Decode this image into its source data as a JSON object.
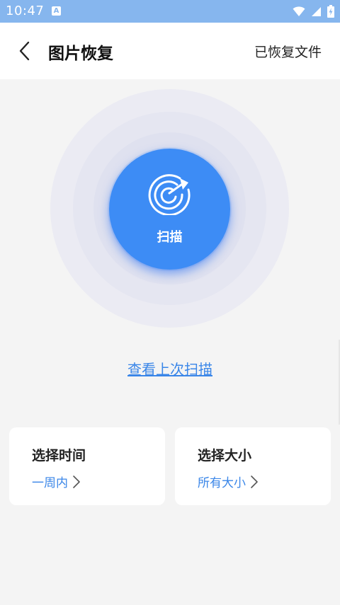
{
  "status_bar": {
    "time": "10:47",
    "app_icon_letter": "A",
    "icons": [
      "wifi-icon",
      "signal-icon",
      "battery-icon"
    ]
  },
  "header": {
    "back_icon": "chevron-left-icon",
    "title": "图片恢复",
    "recovered_files": "已恢复文件"
  },
  "scan": {
    "icon": "radar-icon",
    "label": "扫描"
  },
  "last_scan_link": "查看上次扫描",
  "filters": {
    "time": {
      "title": "选择时间",
      "value": "一周内"
    },
    "size": {
      "title": "选择大小",
      "value": "所有大小"
    }
  },
  "colors": {
    "status_bar": "#86b6ee",
    "accent": "#3d8cf5",
    "link": "#3a86e8",
    "background": "#f4f4f4"
  }
}
